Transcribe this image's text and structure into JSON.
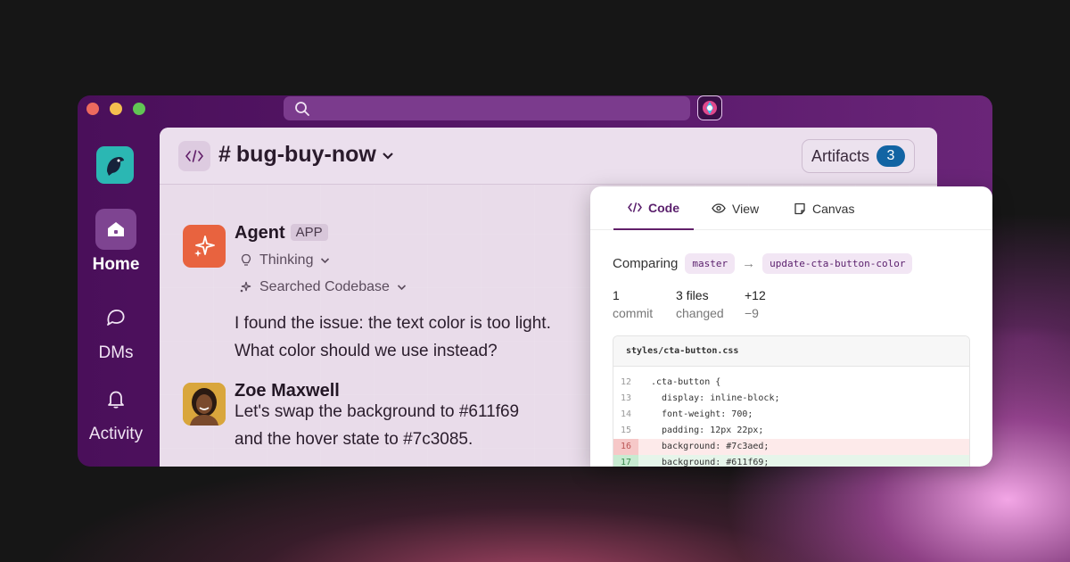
{
  "window": {
    "search_placeholder": ""
  },
  "rail": {
    "items": [
      {
        "label": "Home",
        "icon": "home-icon",
        "active": true
      },
      {
        "label": "DMs",
        "icon": "chat-bubble-icon",
        "active": false
      },
      {
        "label": "Activity",
        "icon": "bell-icon",
        "active": false
      }
    ]
  },
  "channel": {
    "hash": "#",
    "name": "bug-buy-now",
    "artifacts_label": "Artifacts",
    "artifacts_count": "3"
  },
  "messages": [
    {
      "author": "Agent",
      "tag": "APP",
      "thinking": "Thinking",
      "searched": "Searched Codebase",
      "lines": [
        "I found the issue: the text color is too light.",
        "What color should we use instead?"
      ]
    },
    {
      "author": "Zoe Maxwell",
      "lines": [
        "Let's swap the background to #611f69",
        "and the hover state to #7c3085."
      ]
    }
  ],
  "panel": {
    "tabs": [
      {
        "label": "Code",
        "icon": "code-icon",
        "active": true
      },
      {
        "label": "View",
        "icon": "eye-icon",
        "active": false
      },
      {
        "label": "Canvas",
        "icon": "canvas-icon",
        "active": false
      }
    ],
    "comparing_label": "Comparing",
    "base_branch": "master",
    "arrow": "→",
    "head_branch": "update-cta-button-color",
    "stats": {
      "commits_value": "1",
      "commits_label": "commit",
      "files_value": "3 files",
      "files_label": "changed",
      "additions": "+12",
      "deletions": "−9"
    },
    "file": {
      "name": "styles/cta-button.css",
      "lines": [
        {
          "n": "12",
          "code": ".cta-button {",
          "type": "normal"
        },
        {
          "n": "13",
          "code": "  display: inline-block;",
          "type": "normal"
        },
        {
          "n": "14",
          "code": "  font-weight: 700;",
          "type": "normal"
        },
        {
          "n": "15",
          "code": "  padding: 12px 22px;",
          "type": "normal"
        },
        {
          "n": "16",
          "code": "  background: #7c3aed;",
          "type": "del"
        },
        {
          "n": "17",
          "code": "  background: #611f69;",
          "type": "add"
        }
      ]
    }
  },
  "colors": {
    "aubergine": "#611f69",
    "accent_blue": "#1264a3",
    "agent_orange": "#e8633f",
    "logo_teal": "#2bb7b3"
  }
}
